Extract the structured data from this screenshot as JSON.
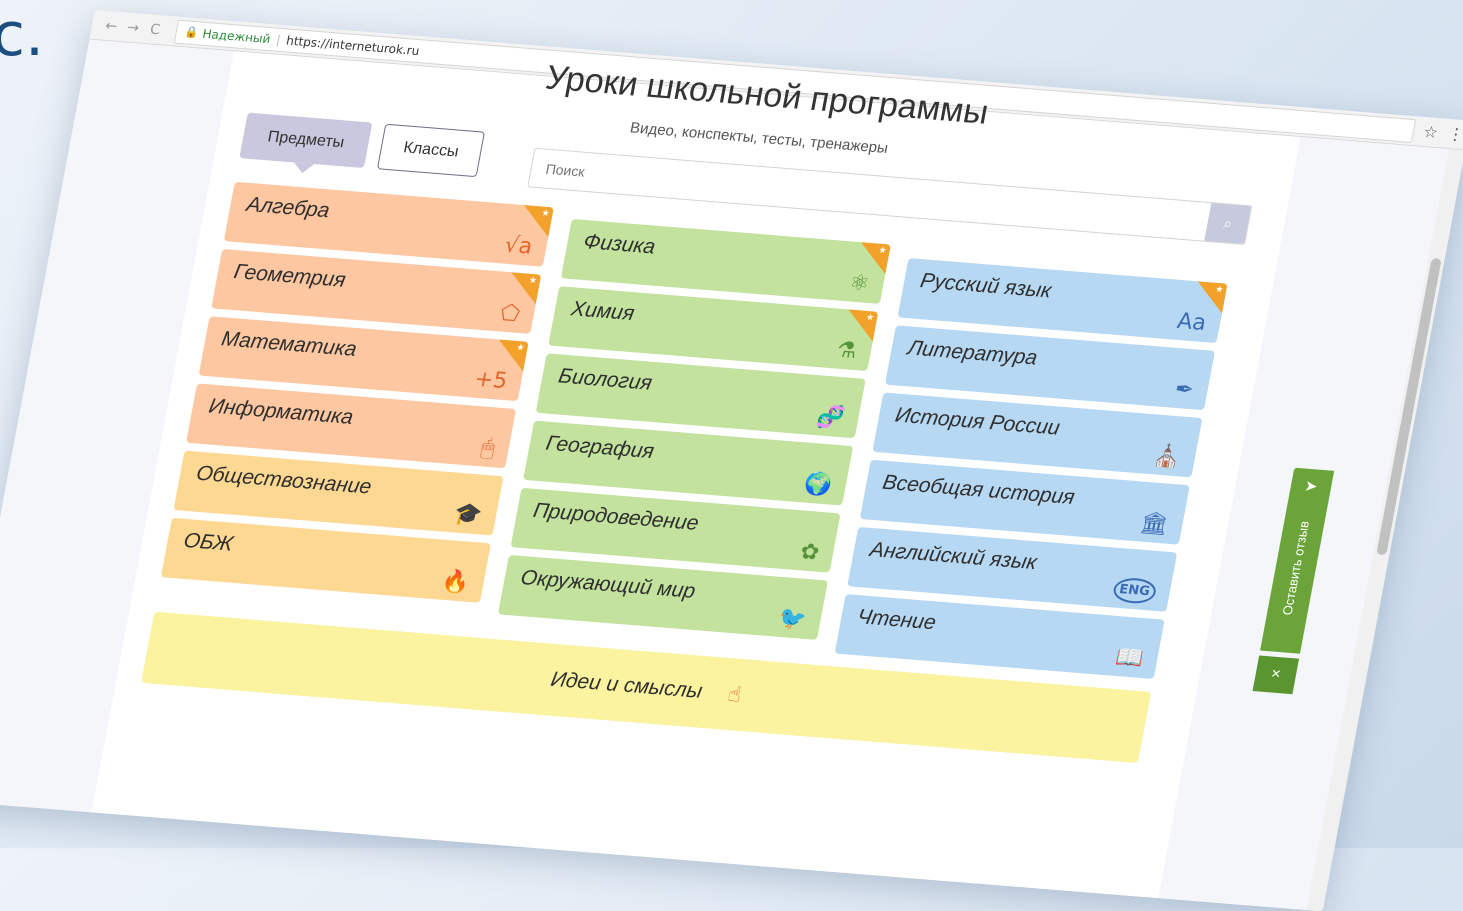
{
  "page_char": "с.",
  "browser": {
    "nav": {
      "back_icon": "←",
      "forward_icon": "→",
      "reload_icon": "C"
    },
    "lock_icon": "🔒",
    "secure_label": "Надежный",
    "url": "https://interneturok.ru",
    "star_icon": "☆",
    "menu_icon": "⋮"
  },
  "header": {
    "title": "Уроки школьной программы",
    "subtitle": "Видео, конспекты, тесты, тренажеры"
  },
  "tabs": {
    "subjects": "Предметы",
    "classes": "Классы"
  },
  "search": {
    "placeholder": "Поиск",
    "button_icon": "⌕"
  },
  "columns": [
    {
      "items": [
        {
          "label": "Алгебра",
          "icon": "√a",
          "starred": true,
          "color": "#fcc7a1"
        },
        {
          "label": "Геометрия",
          "icon": "⬠",
          "starred": true,
          "color": "#fcc7a1"
        },
        {
          "label": "Математика",
          "icon": "+5",
          "starred": true,
          "color": "#fcc7a1"
        },
        {
          "label": "Информатика",
          "icon": "🖱",
          "starred": false,
          "color": "#fcc7a1"
        },
        {
          "label": "Обществознание",
          "icon": "🎓",
          "starred": false,
          "color": "#fdd893"
        },
        {
          "label": "ОБЖ",
          "icon": "🔥",
          "starred": false,
          "color": "#fdd893"
        }
      ]
    },
    {
      "items": [
        {
          "label": "Физика",
          "icon": "⚛",
          "starred": true,
          "color": "#c2e29e"
        },
        {
          "label": "Химия",
          "icon": "⚗",
          "starred": true,
          "color": "#c2e29e"
        },
        {
          "label": "Биология",
          "icon": "🧬",
          "starred": false,
          "color": "#c2e29e"
        },
        {
          "label": "География",
          "icon": "🌍",
          "starred": false,
          "color": "#c2e29e"
        },
        {
          "label": "Природоведение",
          "icon": "✿",
          "starred": false,
          "color": "#c2e29e"
        },
        {
          "label": "Окружающий мир",
          "icon": "🐦",
          "starred": false,
          "color": "#c2e29e"
        }
      ]
    },
    {
      "items": [
        {
          "label": "Русский язык",
          "icon": "Aa",
          "starred": true,
          "color": "#b7d8f2"
        },
        {
          "label": "Литература",
          "icon": "✒",
          "starred": false,
          "color": "#b7d8f2"
        },
        {
          "label": "История России",
          "icon": "⛪",
          "starred": false,
          "color": "#b7d8f2"
        },
        {
          "label": "Всеобщая история",
          "icon": "🏛",
          "starred": false,
          "color": "#b7d8f2"
        },
        {
          "label": "Английский язык",
          "icon": "ENG",
          "starred": false,
          "color": "#b7d8f2"
        },
        {
          "label": "Чтение",
          "icon": "📖",
          "starred": false,
          "color": "#b7d8f2"
        }
      ]
    }
  ],
  "ideas": {
    "label": "Идеи и смыслы",
    "icon": "☝"
  },
  "feedback": {
    "label": "Оставить отзыв",
    "plane_icon": "➤",
    "close_icon": "×"
  },
  "colors": {
    "ribbon": "#f2a22b",
    "feedback": "#6ba53a"
  }
}
